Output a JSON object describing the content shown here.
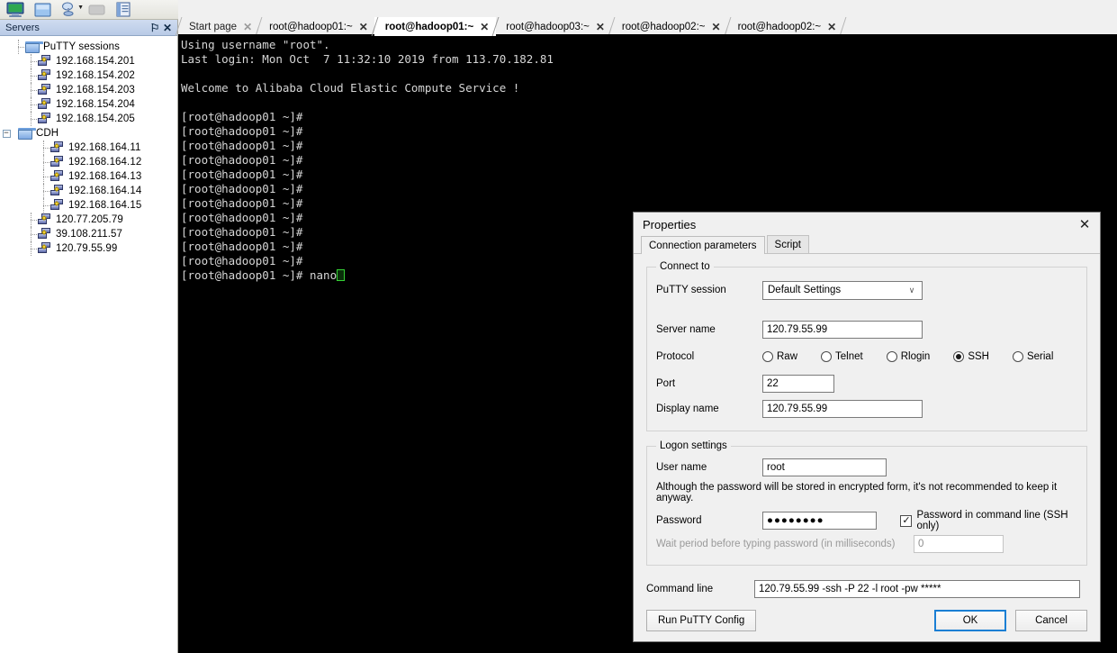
{
  "toolbar": {
    "buttons": [
      {
        "name": "session-icon",
        "label": "Session"
      },
      {
        "name": "new-document-icon",
        "label": "New"
      },
      {
        "name": "satellite-icon",
        "label": "Servers"
      },
      {
        "name": "disabled-tool-icon",
        "label": "Tools"
      },
      {
        "name": "notepad-icon",
        "label": "Editor"
      }
    ]
  },
  "sidebar": {
    "title": "Servers",
    "pin_icon": "⚐",
    "close_icon": "✕",
    "items": [
      {
        "label": "PuTTY sessions",
        "type": "folder",
        "depth": 0,
        "expander": false
      },
      {
        "label": "192.168.154.201",
        "type": "server",
        "depth": 1,
        "expander": false
      },
      {
        "label": "192.168.154.202",
        "type": "server",
        "depth": 1,
        "expander": false
      },
      {
        "label": "192.168.154.203",
        "type": "server",
        "depth": 1,
        "expander": false
      },
      {
        "label": "192.168.154.204",
        "type": "server",
        "depth": 1,
        "expander": false
      },
      {
        "label": "192.168.154.205",
        "type": "server",
        "depth": 1,
        "expander": false
      },
      {
        "label": "CDH",
        "type": "folder",
        "depth": 0,
        "expander": true,
        "expander_glyph": "−"
      },
      {
        "label": "192.168.164.11",
        "type": "server",
        "depth": 2,
        "expander": false
      },
      {
        "label": "192.168.164.12",
        "type": "server",
        "depth": 2,
        "expander": false
      },
      {
        "label": "192.168.164.13",
        "type": "server",
        "depth": 2,
        "expander": false
      },
      {
        "label": "192.168.164.14",
        "type": "server",
        "depth": 2,
        "expander": false
      },
      {
        "label": "192.168.164.15",
        "type": "server",
        "depth": 2,
        "expander": false
      },
      {
        "label": "120.77.205.79",
        "type": "server",
        "depth": 1,
        "expander": false
      },
      {
        "label": "39.108.211.57",
        "type": "server",
        "depth": 1,
        "expander": false
      },
      {
        "label": "120.79.55.99",
        "type": "server",
        "depth": 1,
        "expander": false
      }
    ]
  },
  "tabs": {
    "close_icon": "✕",
    "items": [
      {
        "label": "Start page",
        "active": false,
        "dim": true
      },
      {
        "label": "root@hadoop01:~",
        "active": false,
        "dim": false
      },
      {
        "label": "root@hadoop01:~",
        "active": true,
        "dim": false
      },
      {
        "label": "root@hadoop03:~",
        "active": false,
        "dim": false
      },
      {
        "label": "root@hadoop02:~",
        "active": false,
        "dim": false
      },
      {
        "label": "root@hadoop02:~",
        "active": false,
        "dim": false
      }
    ]
  },
  "terminal": {
    "lines": [
      "Using username \"root\".",
      "Last login: Mon Oct  7 11:32:10 2019 from 113.70.182.81",
      "",
      "Welcome to Alibaba Cloud Elastic Compute Service !",
      "",
      "[root@hadoop01 ~]#",
      "[root@hadoop01 ~]#",
      "[root@hadoop01 ~]#",
      "[root@hadoop01 ~]#",
      "[root@hadoop01 ~]#",
      "[root@hadoop01 ~]#",
      "[root@hadoop01 ~]#",
      "[root@hadoop01 ~]#",
      "[root@hadoop01 ~]#",
      "[root@hadoop01 ~]#",
      "[root@hadoop01 ~]#"
    ],
    "prompt_line": "[root@hadoop01 ~]# nano"
  },
  "dialog": {
    "title": "Properties",
    "close_icon": "✕",
    "tabs": [
      {
        "label": "Connection parameters",
        "active": true
      },
      {
        "label": "Script",
        "active": false
      }
    ],
    "connect_to": {
      "legend": "Connect to",
      "putty_session_label": "PuTTY session",
      "putty_session_value": "Default Settings",
      "combo_arrow": "∨",
      "server_name_label": "Server name",
      "server_name_value": "120.79.55.99",
      "protocol_label": "Protocol",
      "protocols": [
        {
          "label": "Raw",
          "selected": false
        },
        {
          "label": "Telnet",
          "selected": false
        },
        {
          "label": "Rlogin",
          "selected": false
        },
        {
          "label": "SSH",
          "selected": true
        },
        {
          "label": "Serial",
          "selected": false
        }
      ],
      "port_label": "Port",
      "port_value": "22",
      "display_name_label": "Display name",
      "display_name_value": "120.79.55.99"
    },
    "logon_settings": {
      "legend": "Logon settings",
      "user_name_label": "User name",
      "user_name_value": "root",
      "note": "Although the password will be stored in encrypted form, it's not recommended to keep it anyway.",
      "password_label": "Password",
      "password_value": "●●●●●●●●",
      "password_cmdline_label": "Password in command line (SSH only)",
      "password_cmdline_checked": true,
      "check_glyph": "✓",
      "wait_label": "Wait period before typing password (in milliseconds)",
      "wait_value": "0",
      "wait_disabled": true
    },
    "command_line_label": "Command line",
    "command_line_value": "120.79.55.99 -ssh -P 22 -l root -pw *****",
    "footer": {
      "run_putty_config": "Run PuTTY Config",
      "ok": "OK",
      "cancel": "Cancel"
    }
  },
  "colors": {
    "terminal_bg": "#000000",
    "terminal_fg": "#d6d6d6",
    "cursor": "#35d135",
    "focus_blue": "#1a7fd4",
    "panel_header": "#b9cbe6"
  }
}
